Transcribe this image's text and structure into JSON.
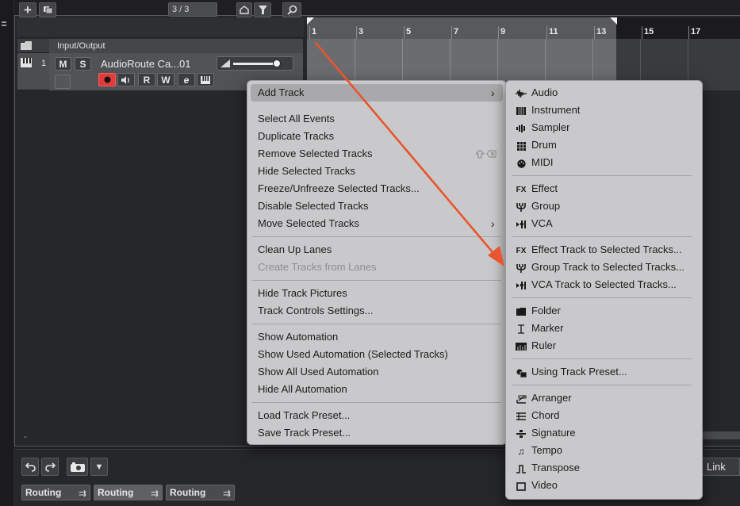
{
  "toolbar": {
    "add_label": "+",
    "counter": "3 / 3"
  },
  "ruler": {
    "bars": [
      "1",
      "3",
      "5",
      "7",
      "9",
      "11",
      "13",
      "15",
      "17"
    ]
  },
  "track_list": {
    "folder_label": "Input/Output",
    "track": {
      "number": "1",
      "name": "AudioRoute Ca...01",
      "mute": "M",
      "solo": "S",
      "read": "R",
      "write": "W",
      "edit": "e"
    }
  },
  "lower_zone": {
    "link_label": "Link",
    "routing_tabs": [
      "Routing",
      "Routing",
      "Routing"
    ]
  },
  "context_menu": {
    "add_track": "Add Track",
    "groups": [
      [
        "Select All Events",
        "Duplicate Tracks",
        "Remove Selected Tracks",
        "Hide Selected Tracks",
        "Freeze/Unfreeze Selected Tracks...",
        "Disable Selected Tracks",
        "Move Selected Tracks"
      ],
      [
        "Clean Up Lanes",
        "Create Tracks from Lanes"
      ],
      [
        "Hide Track Pictures",
        "Track Controls Settings..."
      ],
      [
        "Show Automation",
        "Show Used Automation (Selected Tracks)",
        "Show All Used Automation",
        "Hide All Automation"
      ],
      [
        "Load Track Preset...",
        "Save Track Preset..."
      ]
    ],
    "disabled_item": "Create Tracks from Lanes",
    "submenu_item": "Move Selected Tracks"
  },
  "submenu": {
    "groups": [
      [
        {
          "label": "Audio",
          "icon": "waveform-icon"
        },
        {
          "label": "Instrument",
          "icon": "keyboard-icon"
        },
        {
          "label": "Sampler",
          "icon": "sampler-icon"
        },
        {
          "label": "Drum",
          "icon": "drum-grid-icon"
        },
        {
          "label": "MIDI",
          "icon": "midi-icon"
        }
      ],
      [
        {
          "label": "Effect",
          "icon": "fx-icon"
        },
        {
          "label": "Group",
          "icon": "group-icon"
        },
        {
          "label": "VCA",
          "icon": "vca-icon"
        }
      ],
      [
        {
          "label": "Effect Track to Selected Tracks...",
          "icon": "fx-icon"
        },
        {
          "label": "Group Track to Selected Tracks...",
          "icon": "group-icon"
        },
        {
          "label": "VCA Track to Selected Tracks...",
          "icon": "vca-icon"
        }
      ],
      [
        {
          "label": "Folder",
          "icon": "folder-icon"
        },
        {
          "label": "Marker",
          "icon": "marker-icon"
        },
        {
          "label": "Ruler",
          "icon": "ruler-icon"
        }
      ],
      [
        {
          "label": "Using Track Preset...",
          "icon": "preset-icon"
        }
      ],
      [
        {
          "label": "Arranger",
          "icon": "arranger-icon"
        },
        {
          "label": "Chord",
          "icon": "chord-icon"
        },
        {
          "label": "Signature",
          "icon": "signature-icon"
        },
        {
          "label": "Tempo",
          "icon": "tempo-icon"
        },
        {
          "label": "Transpose",
          "icon": "transpose-icon"
        },
        {
          "label": "Video",
          "icon": "video-icon"
        }
      ]
    ]
  },
  "colors": {
    "record": "#e33b3b",
    "annotation_arrow": "#e8552e",
    "menu_bg": "#c9c9cb",
    "loop_region": "#58595c"
  }
}
